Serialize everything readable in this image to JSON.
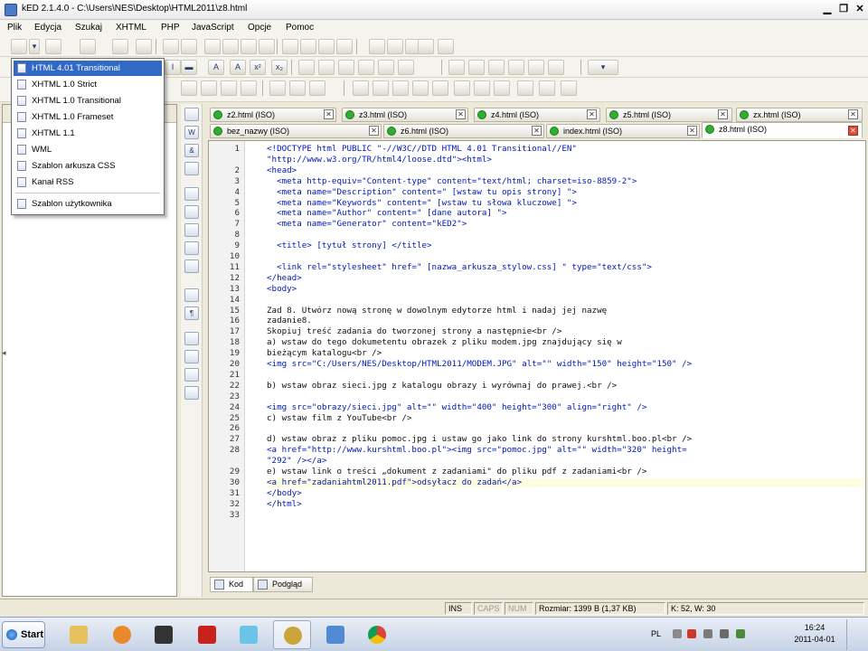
{
  "window": {
    "title": "kED 2.1.4.0 - C:\\Users\\NES\\Desktop\\HTML2011\\z8.html",
    "minimize_glyph": "▁",
    "restore_glyph": "❐",
    "close_glyph": "✕"
  },
  "menu": [
    "Plik",
    "Edycja",
    "Szukaj",
    "XHTML",
    "PHP",
    "JavaScript",
    "Opcje",
    "Pomoc"
  ],
  "toolbar_glyphs": {
    "italic": "I",
    "center_bar": "▬",
    "aa1": "A",
    "aa2": "A",
    "sup": "x²",
    "sub": "x₂"
  },
  "new_document_menu": {
    "items": [
      {
        "label": "HTML 4.01 Transitional",
        "selected": true
      },
      {
        "label": "XHTML 1.0 Strict"
      },
      {
        "label": "XHTML 1.0 Transitional"
      },
      {
        "label": "XHTML 1.0 Frameset"
      },
      {
        "label": "XHTML 1.1"
      },
      {
        "label": "WML"
      },
      {
        "label": "Szablon arkusza CSS"
      },
      {
        "label": "Kanał RSS"
      },
      {
        "label": "Szablon użytkownika"
      }
    ]
  },
  "side_tools": {
    "tool_w": "W",
    "tool_amp": "&",
    "tool_para": "¶"
  },
  "tabs": {
    "row1": [
      {
        "label": "z2.html (ISO)"
      },
      {
        "label": "z3.html (ISO)"
      },
      {
        "label": "z4.html (ISO)"
      },
      {
        "label": "z5.html (ISO)"
      },
      {
        "label": "zx.html (ISO)"
      }
    ],
    "row2": [
      {
        "label": "bez_nazwy (ISO)"
      },
      {
        "label": "z6.html (ISO)"
      },
      {
        "label": "index.html (ISO)"
      },
      {
        "label": "z8.html (ISO)",
        "active": true
      }
    ],
    "close_glyph": "✕"
  },
  "editor": {
    "lines": [
      {
        "n": "1",
        "text": "<!DOCTYPE html PUBLIC \"-//W3C//DTD HTML 4.01 Transitional//EN\"",
        "kind": "tag"
      },
      {
        "n": "",
        "text": "\"http://www.w3.org/TR/html4/loose.dtd\"><html>",
        "kind": "tag"
      },
      {
        "n": "2",
        "text": "<head>",
        "kind": "tag"
      },
      {
        "n": "3",
        "text": "  <meta http-equiv=\"Content-type\" content=\"text/html; charset=iso-8859-2\">",
        "kind": "tag"
      },
      {
        "n": "4",
        "text": "  <meta name=\"Description\" content=\" [wstaw tu opis strony] \">",
        "kind": "tag"
      },
      {
        "n": "5",
        "text": "  <meta name=\"Keywords\" content=\" [wstaw tu słowa kluczowe] \">",
        "kind": "tag"
      },
      {
        "n": "6",
        "text": "  <meta name=\"Author\" content=\" [dane autora] \">",
        "kind": "tag"
      },
      {
        "n": "7",
        "text": "  <meta name=\"Generator\" content=\"kED2\">",
        "kind": "tag"
      },
      {
        "n": "8",
        "text": "",
        "kind": "text"
      },
      {
        "n": "9",
        "text": "  <title> [tytuł strony] </title>",
        "kind": "tag"
      },
      {
        "n": "10",
        "text": "",
        "kind": "text"
      },
      {
        "n": "11",
        "text": "  <link rel=\"stylesheet\" href=\" [nazwa_arkusza_stylow.css] \" type=\"text/css\">",
        "kind": "tag"
      },
      {
        "n": "12",
        "text": "</head>",
        "kind": "tag"
      },
      {
        "n": "13",
        "text": "<body>",
        "kind": "tag"
      },
      {
        "n": "14",
        "text": "",
        "kind": "text"
      },
      {
        "n": "15",
        "text": "Zad 8. Utwórz nową stronę w dowolnym edytorze html i nadaj jej nazwę",
        "kind": "text"
      },
      {
        "n": "16",
        "text": "zadanie8.",
        "kind": "text"
      },
      {
        "n": "17",
        "text": "Skopiuj treść zadania do tworzonej strony a następnie<br />",
        "kind": "text"
      },
      {
        "n": "18",
        "text": "a) wstaw do tego dokumetentu obrazek z pliku modem.jpg znajdujący się w",
        "kind": "text"
      },
      {
        "n": "19",
        "text": "bieżącym katalogu<br />",
        "kind": "text"
      },
      {
        "n": "20",
        "text": "<img src=\"C:/Users/NES/Desktop/HTML2011/MODEM.JPG\" alt=\"\" width=\"150\" height=\"150\" />",
        "kind": "tag"
      },
      {
        "n": "21",
        "text": "",
        "kind": "text"
      },
      {
        "n": "22",
        "text": "b) wstaw obraz sieci.jpg z katalogu obrazy i wyrównaj do prawej.<br />",
        "kind": "text"
      },
      {
        "n": "23",
        "text": "",
        "kind": "text"
      },
      {
        "n": "24",
        "text": "<img src=\"obrazy/sieci.jpg\" alt=\"\" width=\"400\" height=\"300\" align=\"right\" />",
        "kind": "tag"
      },
      {
        "n": "25",
        "text": "c) wstaw film z YouTube<br />",
        "kind": "text"
      },
      {
        "n": "26",
        "text": "",
        "kind": "text"
      },
      {
        "n": "27",
        "text": "d) wstaw obraz z pliku pomoc.jpg i ustaw go jako link do strony kurshtml.boo.pl<br />",
        "kind": "text"
      },
      {
        "n": "28",
        "text": "<a href=\"http://www.kurshtml.boo.pl\"><img src=\"pomoc.jpg\" alt=\"\" width=\"320\" height=",
        "kind": "tag"
      },
      {
        "n": "",
        "text": "\"292\" /></a>",
        "kind": "tag"
      },
      {
        "n": "29",
        "text": "e) wstaw link o treści „dokument z zadaniami\" do pliku pdf z zadaniami<br />",
        "kind": "text"
      },
      {
        "n": "30",
        "text": "<a href=\"zadaniahtml2011.pdf\">odsyłacz do zadań</a>",
        "kind": "tag",
        "current": true
      },
      {
        "n": "31",
        "text": "</body>",
        "kind": "tag"
      },
      {
        "n": "32",
        "text": "</html>",
        "kind": "tag"
      },
      {
        "n": "33",
        "text": "",
        "kind": "text"
      }
    ]
  },
  "bottom_tabs": {
    "code": "Kod",
    "preview": "Podgląd"
  },
  "status": {
    "ins": "INS",
    "caps": "CAPS",
    "num": "NUM",
    "size": "Rozmiar: 1399 B (1,37 KB)",
    "pos": "K: 52, W: 30"
  },
  "taskbar": {
    "start": "Start",
    "lang": "PL",
    "time": "16:24",
    "date": "2011-04-01"
  }
}
